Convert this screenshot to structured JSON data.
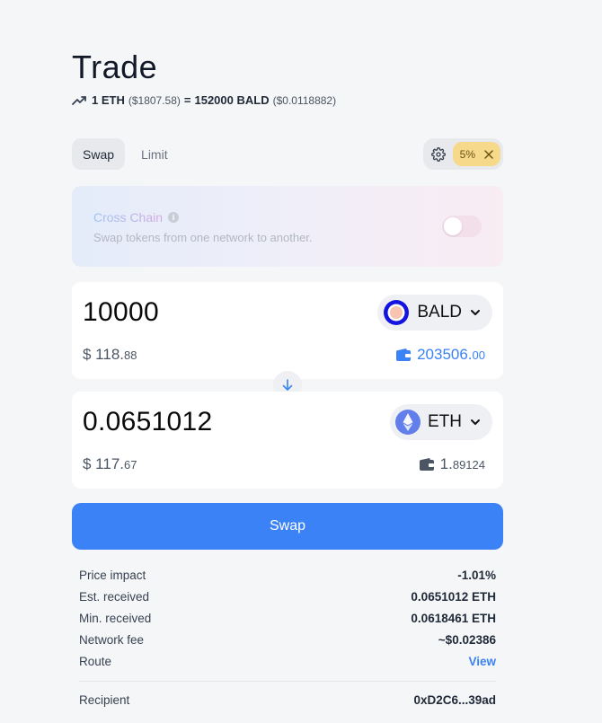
{
  "header": {
    "title": "Trade",
    "rate": {
      "left_amount": "1 ETH",
      "left_usd": "($1807.58)",
      "equals": "=",
      "right_amount": "152000 BALD",
      "right_usd": "($0.0118882)"
    }
  },
  "tabs": [
    {
      "label": "Swap",
      "active": true
    },
    {
      "label": "Limit",
      "active": false
    }
  ],
  "settings": {
    "icon": "gear-icon",
    "slippage": "5%",
    "clear_icon": "close-icon"
  },
  "cross_chain": {
    "title": "Cross Chain",
    "info": "i",
    "subtitle": "Swap tokens from one network to another.",
    "enabled": false
  },
  "from": {
    "amount": "10000",
    "token": "BALD",
    "usd_int": "$ 118.",
    "usd_dec": "88",
    "balance_int": "203506.",
    "balance_dec": "00"
  },
  "to": {
    "amount": "0.0651012",
    "token": "ETH",
    "usd_int": "$ 117.",
    "usd_dec": "67",
    "balance_int": "1.",
    "balance_dec": "89124"
  },
  "swap_button": "Swap",
  "details": [
    {
      "label": "Price impact",
      "value": "-1.01%"
    },
    {
      "label": "Est. received",
      "value": "0.0651012 ETH"
    },
    {
      "label": "Min. received",
      "value": "0.0618461 ETH"
    },
    {
      "label": "Network fee",
      "value": "~$0.02386"
    },
    {
      "label": "Route",
      "value": "View"
    }
  ],
  "recipient": {
    "label": "Recipient",
    "value": "0xD2C6...39ad"
  },
  "colors": {
    "accent": "#3b82f6",
    "slippage_bg": "#f6d98a",
    "background": "#f5f6f8"
  }
}
